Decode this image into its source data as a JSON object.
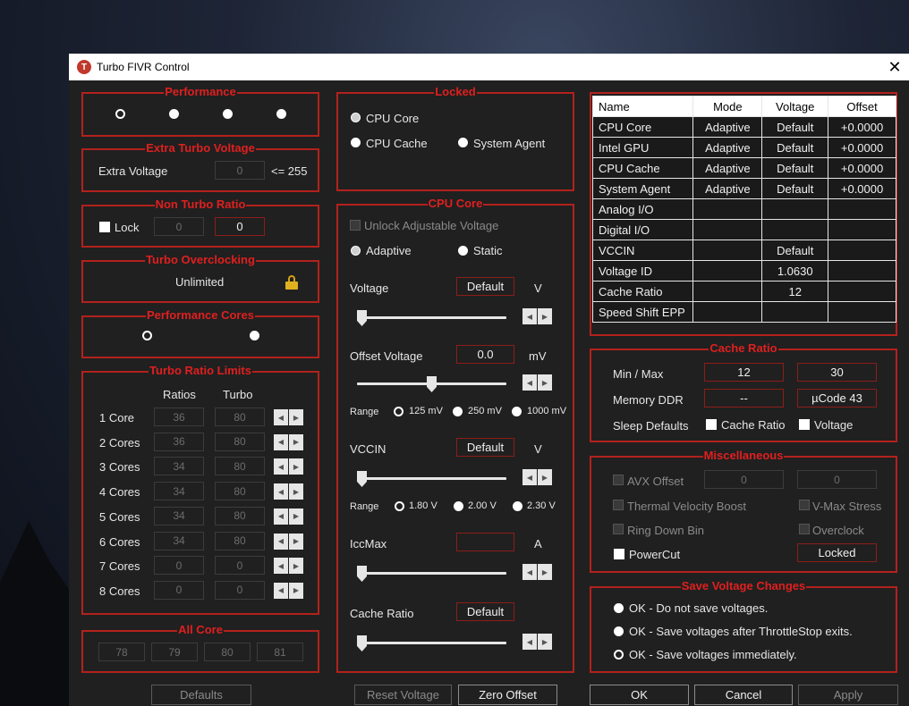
{
  "window": {
    "title": "Turbo FIVR Control",
    "app_icon_letter": "T",
    "close": "✕"
  },
  "groups": {
    "performance": "Performance",
    "extra_turbo_voltage": "Extra Turbo Voltage",
    "non_turbo_ratio": "Non Turbo Ratio",
    "turbo_overclocking": "Turbo Overclocking",
    "performance_cores": "Performance Cores",
    "turbo_ratio_limits": "Turbo Ratio Limits",
    "all_core": "All Core",
    "locked": "Locked",
    "cpu_core": "CPU Core",
    "cache_ratio": "Cache Ratio",
    "miscellaneous": "Miscellaneous",
    "save_voltage_changes": "Save Voltage Changes"
  },
  "extra_turbo": {
    "label": "Extra Voltage",
    "value": "0",
    "limit": "<= 255"
  },
  "non_turbo": {
    "lock_label": "Lock",
    "value1": "0",
    "value2": "0"
  },
  "turbo_oc": {
    "value": "Unlimited"
  },
  "trl": {
    "col_ratios": "Ratios",
    "col_turbo": "Turbo",
    "rows": [
      {
        "label": "1 Core",
        "ratio": "36",
        "turbo": "80"
      },
      {
        "label": "2 Cores",
        "ratio": "36",
        "turbo": "80"
      },
      {
        "label": "3 Cores",
        "ratio": "34",
        "turbo": "80"
      },
      {
        "label": "4 Cores",
        "ratio": "34",
        "turbo": "80"
      },
      {
        "label": "5 Cores",
        "ratio": "34",
        "turbo": "80"
      },
      {
        "label": "6 Cores",
        "ratio": "34",
        "turbo": "80"
      },
      {
        "label": "7 Cores",
        "ratio": "0",
        "turbo": "0"
      },
      {
        "label": "8 Cores",
        "ratio": "0",
        "turbo": "0"
      }
    ]
  },
  "all_core": {
    "values": [
      "78",
      "79",
      "80",
      "81"
    ]
  },
  "locked": {
    "cpu_core": "CPU Core",
    "cpu_cache": "CPU Cache",
    "system_agent": "System Agent"
  },
  "cpu_core": {
    "unlock_label": "Unlock Adjustable Voltage",
    "adaptive": "Adaptive",
    "static": "Static",
    "voltage_label": "Voltage",
    "voltage_value": "Default",
    "voltage_unit": "V",
    "offset_label": "Offset Voltage",
    "offset_value": "0.0",
    "offset_unit": "mV",
    "range_label": "Range",
    "range_opts": [
      "125 mV",
      "250 mV",
      "1000 mV"
    ],
    "vccin_label": "VCCIN",
    "vccin_value": "Default",
    "vccin_unit": "V",
    "vccin_range_opts": [
      "1.80 V",
      "2.00 V",
      "2.30 V"
    ],
    "iccmax_label": "IccMax",
    "iccmax_value": "",
    "iccmax_unit": "A",
    "cache_ratio_label": "Cache Ratio",
    "cache_ratio_value": "Default"
  },
  "voltage_table": {
    "headers": [
      "Name",
      "Mode",
      "Voltage",
      "Offset"
    ],
    "rows": [
      [
        "CPU Core",
        "Adaptive",
        "Default",
        "+0.0000"
      ],
      [
        "Intel GPU",
        "Adaptive",
        "Default",
        "+0.0000"
      ],
      [
        "CPU Cache",
        "Adaptive",
        "Default",
        "+0.0000"
      ],
      [
        "System Agent",
        "Adaptive",
        "Default",
        "+0.0000"
      ],
      [
        "Analog I/O",
        "",
        "",
        ""
      ],
      [
        "Digital I/O",
        "",
        "",
        ""
      ],
      [
        "VCCIN",
        "",
        "Default",
        ""
      ],
      [
        "Voltage ID",
        "",
        "1.0630",
        ""
      ],
      [
        "Cache Ratio",
        "",
        "12",
        ""
      ],
      [
        "Speed Shift EPP",
        "",
        "",
        ""
      ]
    ]
  },
  "cache_ratio": {
    "minmax_label": "Min / Max",
    "min": "12",
    "max": "30",
    "memory_label": "Memory DDR",
    "memory_value": "--",
    "ucode": "µCode 43",
    "sleep_label": "Sleep Defaults",
    "cb_cache": "Cache Ratio",
    "cb_voltage": "Voltage"
  },
  "misc": {
    "avx_label": "AVX Offset",
    "avx1": "0",
    "avx2": "0",
    "tvb": "Thermal Velocity Boost",
    "vmax": "V-Max Stress",
    "rdb": "Ring Down Bin",
    "overclock": "Overclock",
    "powercut": "PowerCut",
    "locked_btn": "Locked"
  },
  "save": {
    "opt1": "OK - Do not save voltages.",
    "opt2": "OK - Save voltages after ThrottleStop exits.",
    "opt3": "OK - Save voltages immediately."
  },
  "buttons": {
    "defaults": "Defaults",
    "reset_voltage": "Reset Voltage",
    "zero_offset": "Zero Offset",
    "ok": "OK",
    "cancel": "Cancel",
    "apply": "Apply"
  }
}
